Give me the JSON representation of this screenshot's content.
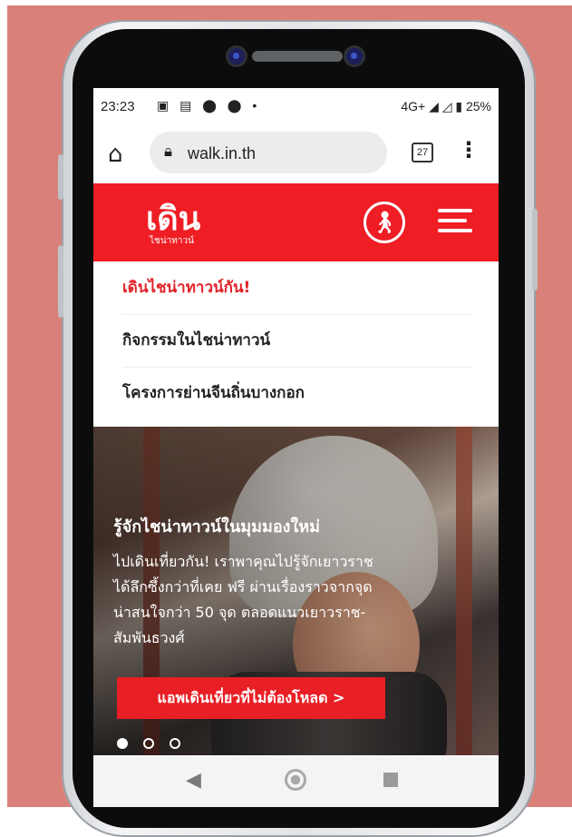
{
  "status_bar": {
    "time": "23:23",
    "notification_icons": "▣ ▤ ⬤ ⬤ •",
    "right": "4G+ ◢ ◿ ▮ 25%"
  },
  "browser": {
    "url": "walk.in.th",
    "tab_count": "27"
  },
  "site": {
    "logo_main": "เดิน",
    "logo_sub": "ไชน่าทาวน์"
  },
  "nav": {
    "items": [
      "เดินไชน่าทาวน์กัน!",
      "กิจกรรมในไชน่าทาวน์",
      "โครงการย่านจีนถิ่นบางกอก"
    ]
  },
  "hero": {
    "title": "รู้จักไชน่าทาวน์ในมุมมองใหม่",
    "description": "ไปเดินเที่ยวกัน! เราพาคุณไปรู้จักเยาวราชได้ลึกซึ้งกว่าที่เคย ฟรี ผ่านเรื่องราวจากจุดน่าสนใจกว่า 50 จุด ตลอดแนวเยาวราช-สัมพันธวงศ์",
    "cta": "แอพเดินเที่ยวที่ไม่ต้องโหลด >"
  },
  "colors": {
    "brand_red": "#ee1e24",
    "background": "#d98079"
  }
}
